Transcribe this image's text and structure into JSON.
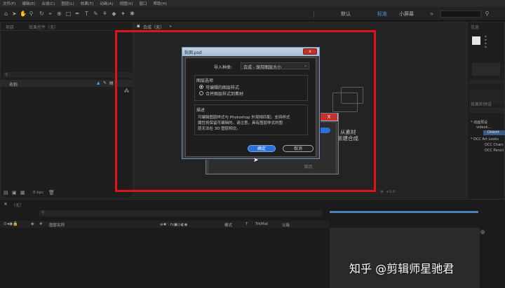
{
  "menubar": {
    "items": [
      "文件(F)",
      "编辑(E)",
      "合成(C)",
      "图层(L)",
      "效果(T)",
      "动画(A)",
      "视图(V)",
      "窗口",
      "帮助(H)"
    ]
  },
  "workspaces": {
    "default": "默认",
    "standard": "标准",
    "small_screen": "小屏幕"
  },
  "project_panel": {
    "tab_project": "项目",
    "tab_effects": "效果控件（无）",
    "column_name": "名称",
    "bpc": "8 bpc"
  },
  "comp_panel": {
    "tab": "合成（无）",
    "tab_extra": "▸",
    "hint_line1": "从素材",
    "hint_line2": "新建合成",
    "zoom": "+0.0"
  },
  "dialog": {
    "title": "轨图.psd",
    "import_type_label": "导入种类:",
    "import_type_value": "合成 - 保持图层大小",
    "layer_options_title": "图层选项",
    "option_editable": "可编辑的图层样式",
    "option_merge": "合并图层样式到素材",
    "description_title": "描述",
    "description_line1": "可编辑图层样式与 Photoshop 外观相匹配。支持样式",
    "description_line2": "属性将保留可编辑的。请注意，具有图层样式的图",
    "description_line3": "层无法在 3D 图层相交。",
    "ok_label": "确定",
    "cancel_label": "取消",
    "close_label": "x"
  },
  "dialog2": {
    "close_label": "X",
    "button_label": "取消"
  },
  "right_panel": {
    "tab_info": "信息",
    "tab_effects": "效果和预设",
    "tree_item1": "* 动画预设",
    "tree_item2": "videok...",
    "tree_item3": "Distort",
    "tree_item4": "* DCC Art Looks",
    "tree_item5": "DCC Charc",
    "tree_item6": "DCC Pencil"
  },
  "timeline": {
    "tab": "（无）",
    "col_source": "图层名称",
    "col_mode": "模式",
    "col_trkmat": "TrkMat",
    "col_parent": "父级"
  },
  "watermark": "知乎 @剪辑师星驰君",
  "colors": {
    "accent": "#4a9de0",
    "highlight": "#e0121a",
    "button": "#2c6fd6"
  }
}
